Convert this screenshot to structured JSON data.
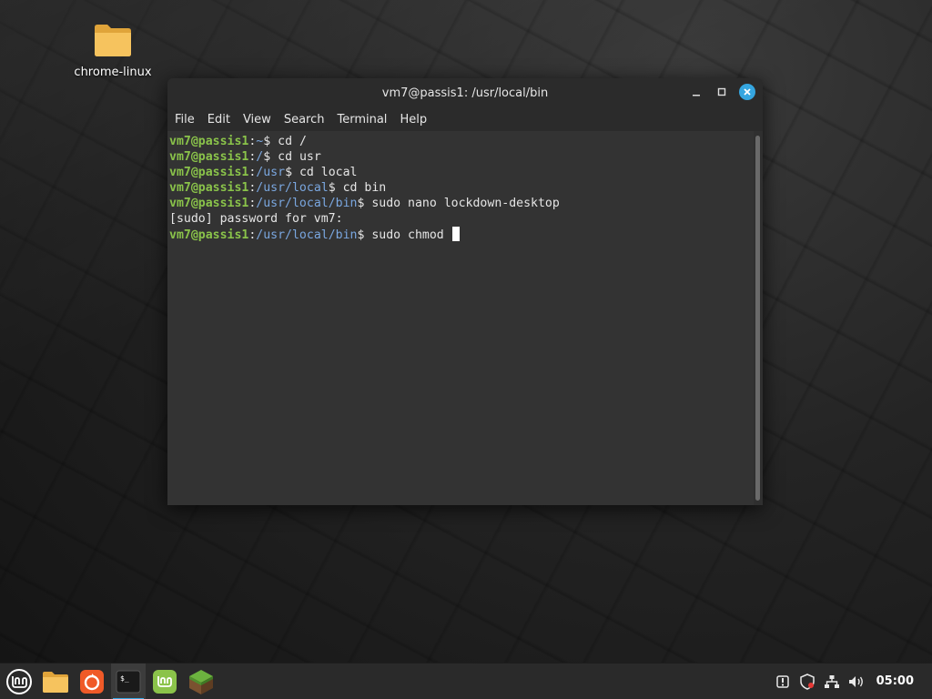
{
  "desktop": {
    "icons": [
      {
        "label": "chrome-linux",
        "icon": "folder-icon"
      }
    ]
  },
  "window": {
    "title": "vm7@passis1: /usr/local/bin",
    "menu": [
      "File",
      "Edit",
      "View",
      "Search",
      "Terminal",
      "Help"
    ]
  },
  "terminal": {
    "lines": [
      {
        "user": "vm7@passis1",
        "path": "~",
        "cmd": "cd /"
      },
      {
        "user": "vm7@passis1",
        "path": "/",
        "cmd": "cd usr"
      },
      {
        "user": "vm7@passis1",
        "path": "/usr",
        "cmd": "cd local"
      },
      {
        "user": "vm7@passis1",
        "path": "/usr/local",
        "cmd": "cd bin"
      },
      {
        "user": "vm7@passis1",
        "path": "/usr/local/bin",
        "cmd": "sudo nano lockdown-desktop"
      },
      {
        "output": "[sudo] password for vm7:"
      },
      {
        "user": "vm7@passis1",
        "path": "/usr/local/bin",
        "cmd": "sudo chmod "
      }
    ]
  },
  "taskbar": {
    "apps": [
      {
        "icon": "files-icon"
      },
      {
        "icon": "firefox-icon"
      },
      {
        "icon": "terminal-icon",
        "active": true
      },
      {
        "icon": "mint-update-icon"
      },
      {
        "icon": "minecraft-icon"
      }
    ],
    "tray": [
      "notification-icon",
      "shield-icon",
      "network-icon",
      "volume-icon"
    ],
    "clock": "05:00"
  },
  "colors": {
    "accent": "#35a6e0",
    "prompt_user": "#8ac34a",
    "prompt_path": "#7aa7e0"
  }
}
